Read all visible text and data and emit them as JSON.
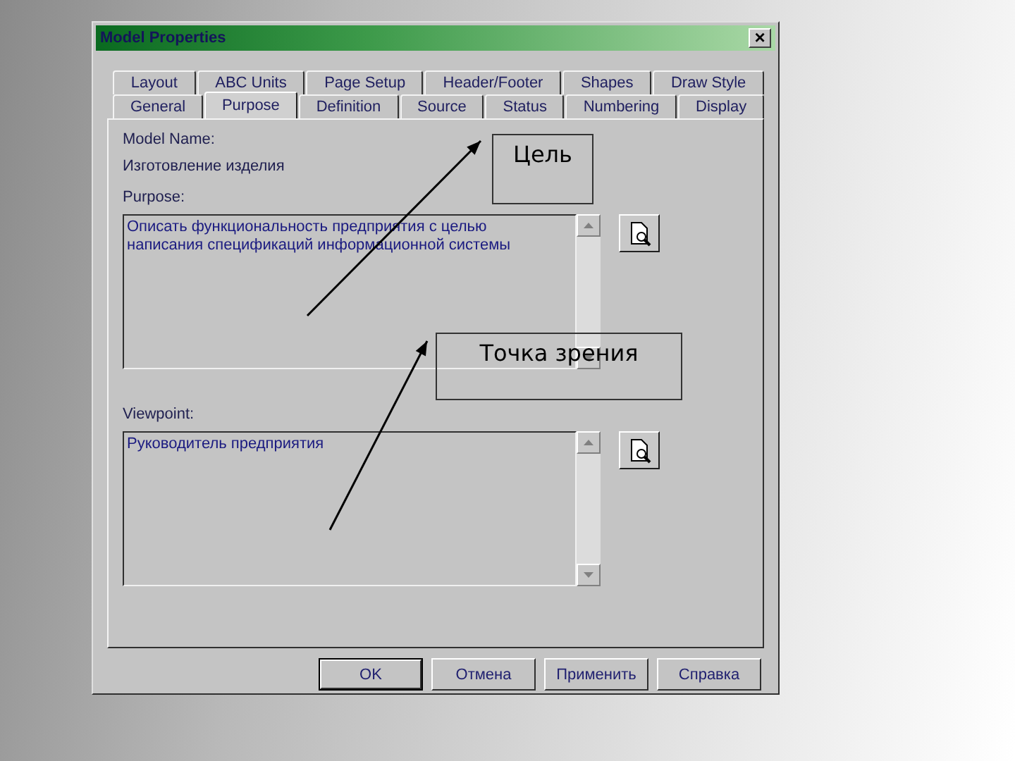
{
  "window": {
    "title": "Model Properties",
    "close": "×"
  },
  "tab_rows": [
    {
      "tabs": [
        {
          "label": "Layout",
          "selected": false
        },
        {
          "label": "ABC Units",
          "selected": false
        },
        {
          "label": "Page Setup",
          "selected": false
        },
        {
          "label": "Header/Footer",
          "selected": false
        },
        {
          "label": "Shapes",
          "selected": false
        },
        {
          "label": "Draw Style",
          "selected": false
        }
      ]
    },
    {
      "tabs": [
        {
          "label": "General",
          "selected": false
        },
        {
          "label": "Purpose",
          "selected": true
        },
        {
          "label": "Definition",
          "selected": false
        },
        {
          "label": "Source",
          "selected": false
        },
        {
          "label": "Status",
          "selected": false
        },
        {
          "label": "Numbering",
          "selected": false
        },
        {
          "label": "Display",
          "selected": false
        }
      ]
    }
  ],
  "model_name": {
    "label": "Model Name:",
    "value": "Изготовление изделия"
  },
  "fields": [
    {
      "label": "Purpose:",
      "value": "Описать функциональность предприятия с целью написания спецификаций информационной системы"
    },
    {
      "label": "Viewpoint:",
      "value": "Руководитель предприятия"
    }
  ],
  "buttons": [
    {
      "label": "OK",
      "selected": true
    },
    {
      "label": "Отмена",
      "selected": false
    },
    {
      "label": "Применить",
      "selected": false
    },
    {
      "label": "Справка",
      "selected": false
    }
  ],
  "callouts": [
    {
      "text": "Цель"
    },
    {
      "text": "Точка зрения"
    }
  ]
}
